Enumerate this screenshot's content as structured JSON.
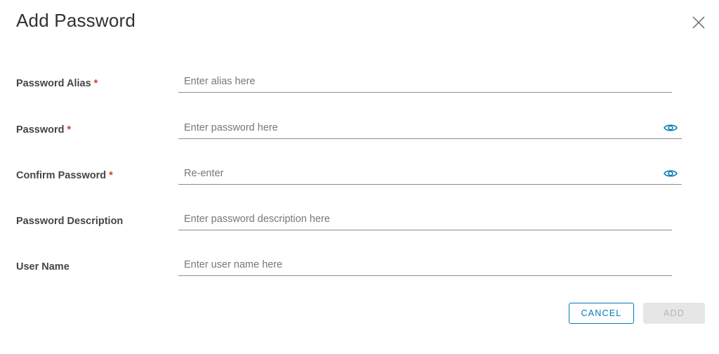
{
  "dialog": {
    "title": "Add Password",
    "close_icon": "close-icon"
  },
  "form": {
    "fields": [
      {
        "label": "Password Alias",
        "required_mark": "*",
        "placeholder": "Enter alias here",
        "value": ""
      },
      {
        "label": "Password",
        "required_mark": "*",
        "placeholder": "Enter password here",
        "value": "",
        "icon": "eye-icon"
      },
      {
        "label": "Confirm Password",
        "required_mark": "*",
        "placeholder": "Re-enter",
        "value": "",
        "icon": "eye-icon"
      },
      {
        "label": "Password Description",
        "required_mark": "",
        "placeholder": "Enter password description here",
        "value": ""
      },
      {
        "label": "User Name",
        "required_mark": "",
        "placeholder": "Enter user name here",
        "value": ""
      }
    ]
  },
  "actions": {
    "cancel_label": "CANCEL",
    "add_label": "ADD"
  },
  "colors": {
    "accent": "#0079b8",
    "required": "#d83b2b",
    "disabled_bg": "#e6e6e6",
    "disabled_text": "#b5b5b5"
  }
}
